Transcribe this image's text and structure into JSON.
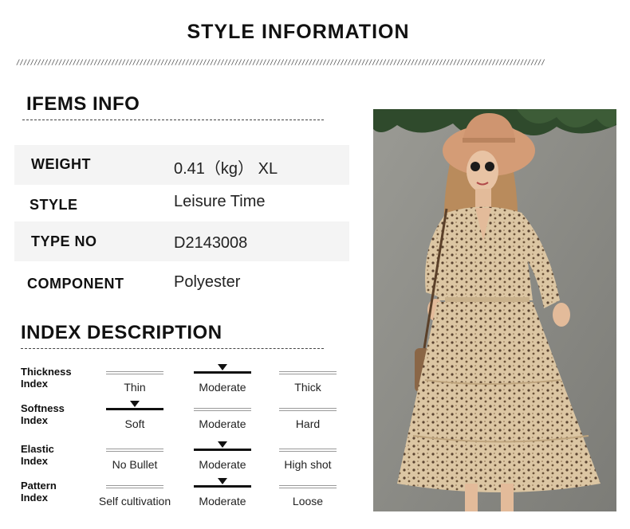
{
  "title": "STYLE INFORMATION",
  "items_info": {
    "heading": "IFEMS INFO",
    "rows": [
      {
        "key": "WEIGHT",
        "value": "0.41（kg） XL"
      },
      {
        "key": "STYLE",
        "value": "Leisure Time"
      },
      {
        "key": "TYPE NO",
        "value": "D2143008"
      },
      {
        "key": "COMPONENT",
        "value": "Polyester"
      }
    ]
  },
  "index_description": {
    "heading": "INDEX DESCRIPTION",
    "indices": [
      {
        "label_line1": "Thickness",
        "label_line2": "Index",
        "options": [
          "Thin",
          "Moderate",
          "Thick"
        ],
        "selected": 1
      },
      {
        "label_line1": "Softness",
        "label_line2": "Index",
        "options": [
          "Soft",
          "Moderate",
          "Hard"
        ],
        "selected": 0
      },
      {
        "label_line1": "Elastic",
        "label_line2": "Index",
        "options": [
          "No Bullet",
          "Moderate",
          "High shot"
        ],
        "selected": 1
      },
      {
        "label_line1": "Pattern",
        "label_line2": "Index",
        "options": [
          "Self cultivation",
          "Moderate",
          "Loose"
        ],
        "selected": 1
      }
    ]
  },
  "colors": {
    "background": "#ffffff",
    "row_shade": "#f4f4f4",
    "text": "#111111",
    "dress": "#d9c3a0",
    "hat": "#d8a07a",
    "wall": "#8b8b86"
  }
}
